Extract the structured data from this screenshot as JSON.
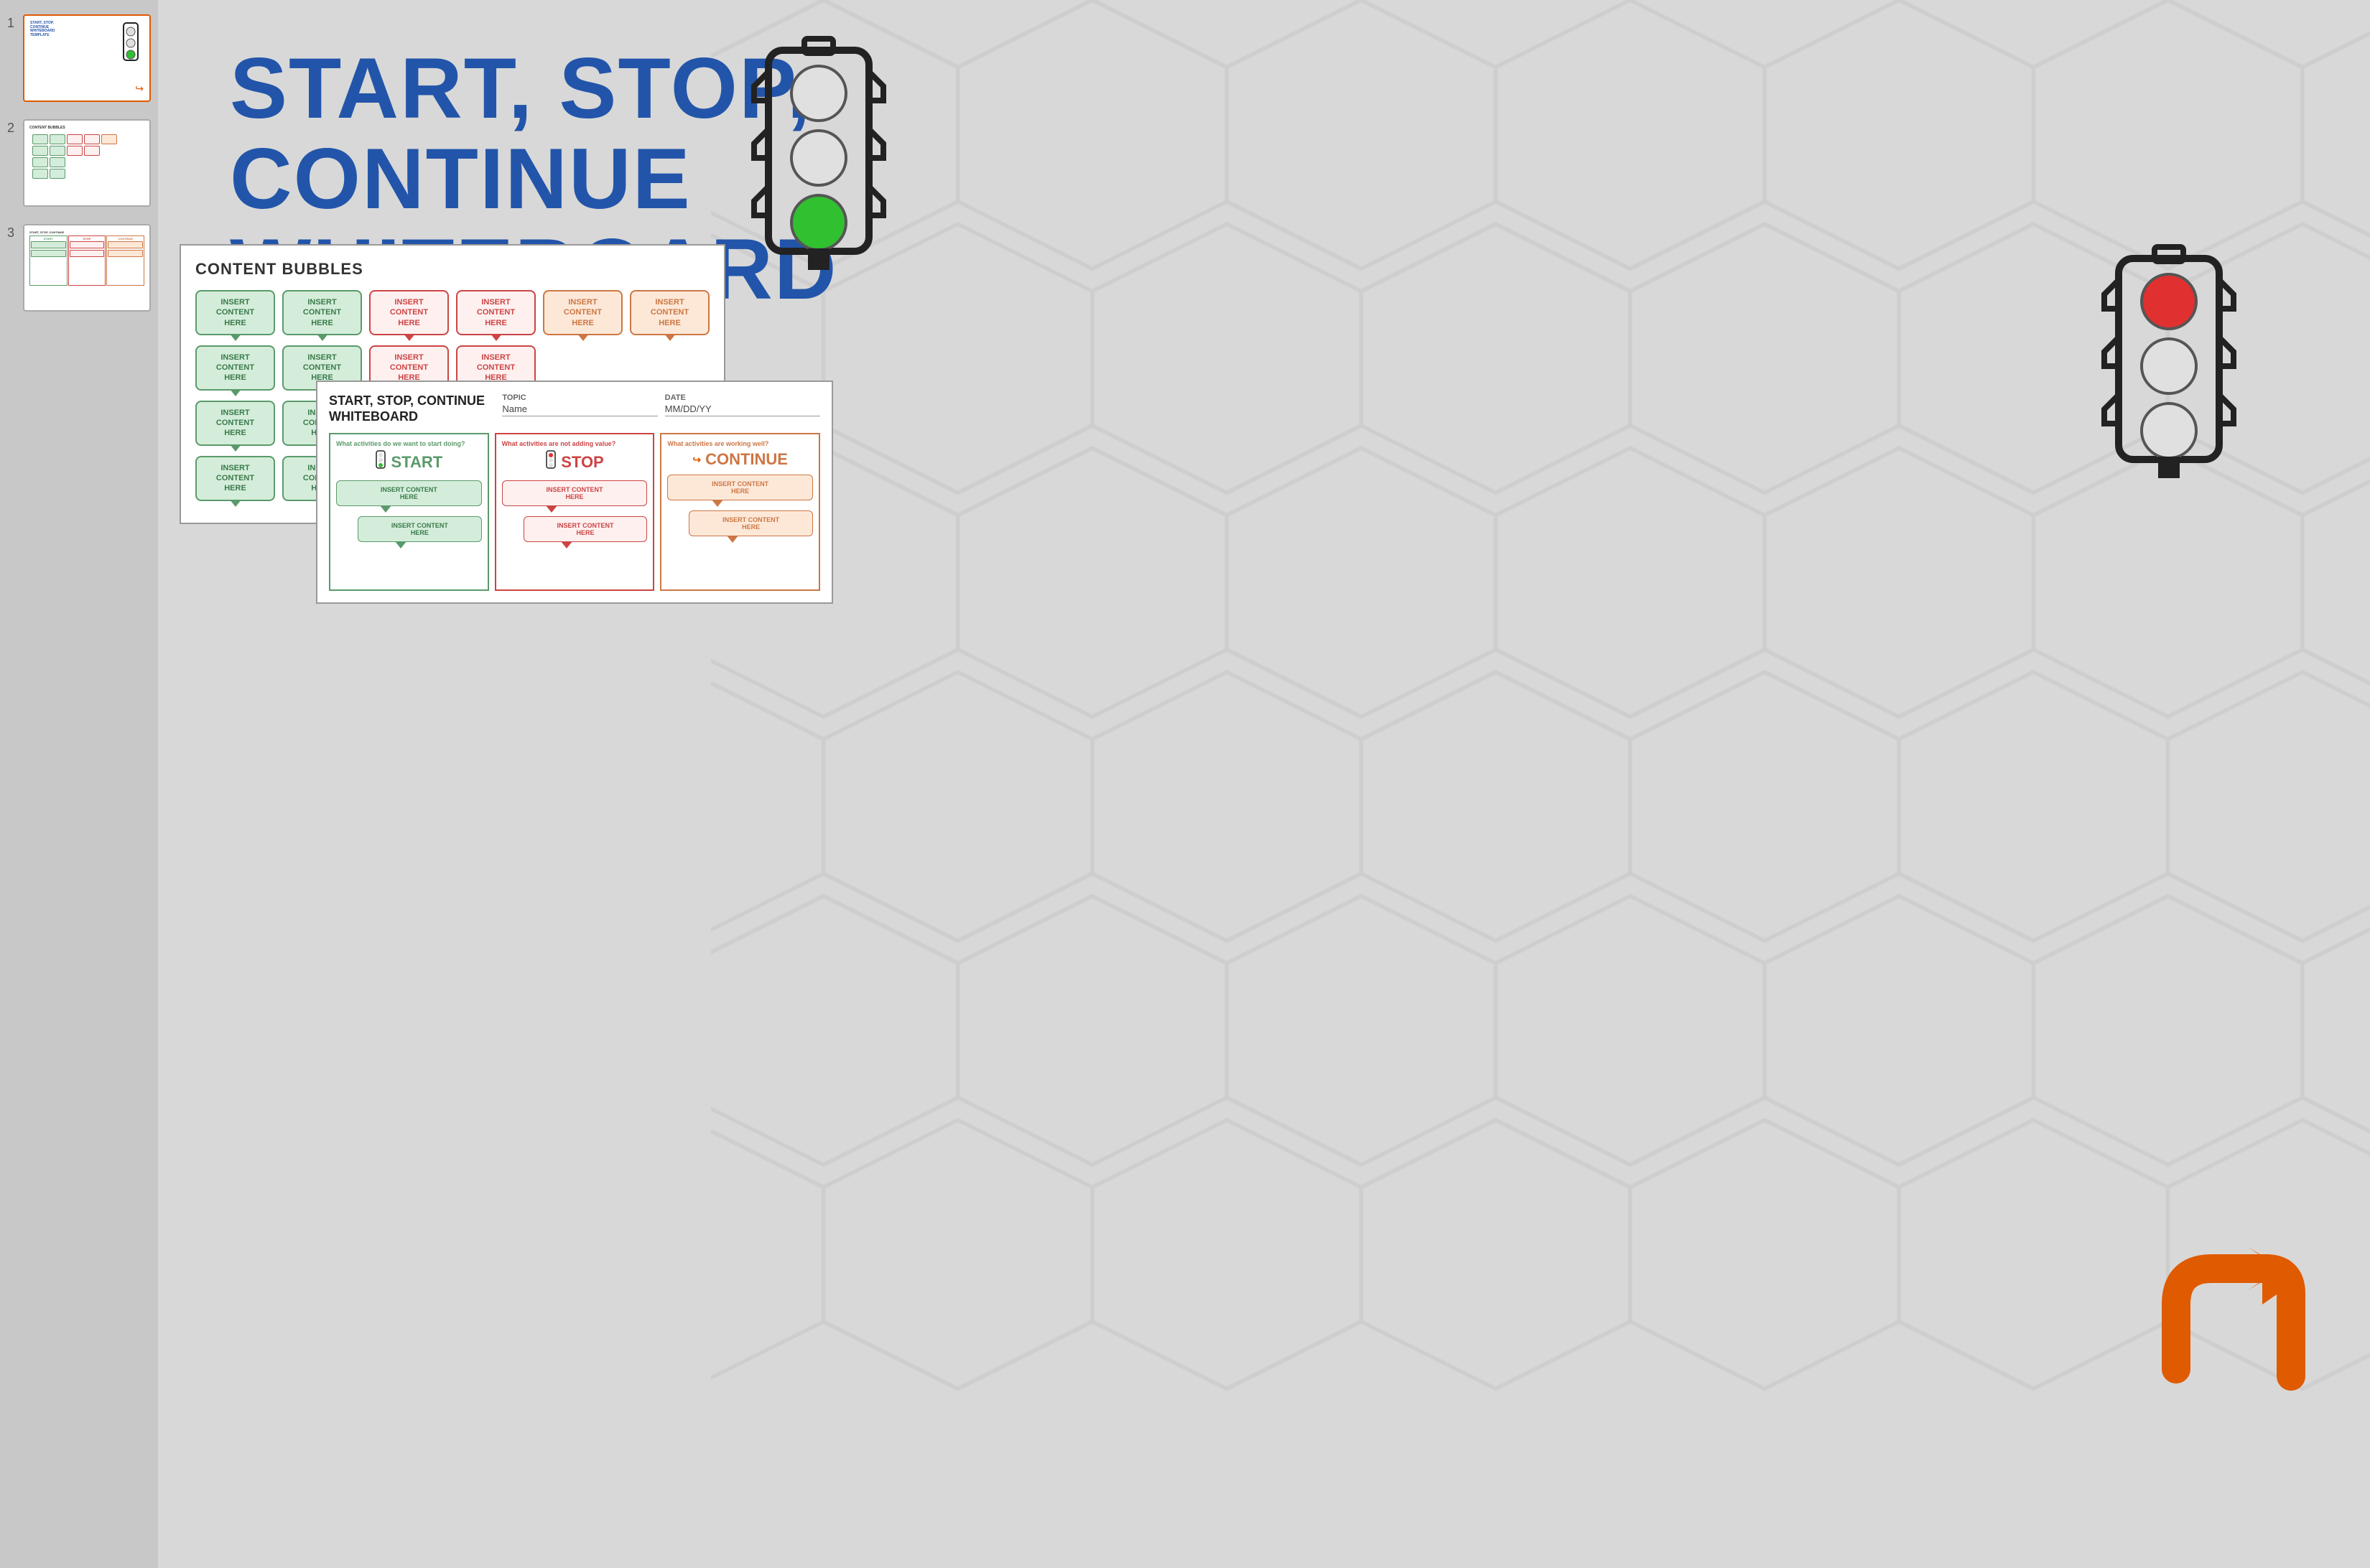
{
  "sidebar": {
    "slides": [
      {
        "num": "1",
        "active": true
      },
      {
        "num": "2",
        "active": false
      },
      {
        "num": "3",
        "active": false
      }
    ]
  },
  "main": {
    "title_line1": "START, STOP,",
    "title_line2": "CONTINUE",
    "title_line3": "WHITEBOARD",
    "title_line4": "TEMPLATE"
  },
  "content_bubbles": {
    "panel_title": "CONTENT BUBBLES",
    "rows": [
      {
        "green": [
          "INSERT CONTENT\nHERE",
          "INSERT CONTENT\nHERE"
        ],
        "red": [
          "INSERT CONTENT\nHERE",
          "INSERT CONTENT\nHERE"
        ],
        "orange": [
          "INSERT CONTENT\nHERE",
          "INSERT CONTENT\nHERE"
        ]
      },
      {
        "green": [
          "INSERT CONTENT\nHERE",
          "INSERT CONTENT\nHERE"
        ],
        "red": [
          "INSERT CONTENT\nHERE",
          "INSERT CONTENT\nHERE"
        ],
        "orange": []
      },
      {
        "green": [
          "INSERT CONTENT\nHERE",
          "INSERT CONTENT\nHERE"
        ],
        "red": [],
        "orange": []
      },
      {
        "green": [
          "INSERT CONTENT\nHERE",
          "INSERT CONTENT\nHERE"
        ],
        "red": [],
        "orange": []
      }
    ]
  },
  "whiteboard": {
    "title": "START, STOP, CONTINUE\nWHITEBOARD",
    "topic_label": "TOPIC",
    "date_label": "DATE",
    "topic_value": "Name",
    "date_value": "MM/DD/YY",
    "start": {
      "question": "What activities do we want to start doing?",
      "header": "START",
      "bubbles": [
        "INSERT CONTENT\nHERE",
        "INSERT CONTENT\nHERE"
      ]
    },
    "stop": {
      "question": "What activities are not adding value?",
      "header": "STOP",
      "bubbles": [
        "INSERT CONTENT\nHERE",
        "INSERT CONTENT\nHERE"
      ]
    },
    "continue": {
      "question": "What activities are working well?",
      "header": "CONTINUE",
      "bubbles": [
        "INSERT CONTENT\nHERE",
        "INSERT CONTENT\nHERE"
      ]
    }
  },
  "colors": {
    "title_blue": "#2255aa",
    "start_green": "#5a9a6a",
    "stop_red": "#cc4444",
    "continue_orange": "#cc7744",
    "arrow_orange": "#e05a00"
  }
}
